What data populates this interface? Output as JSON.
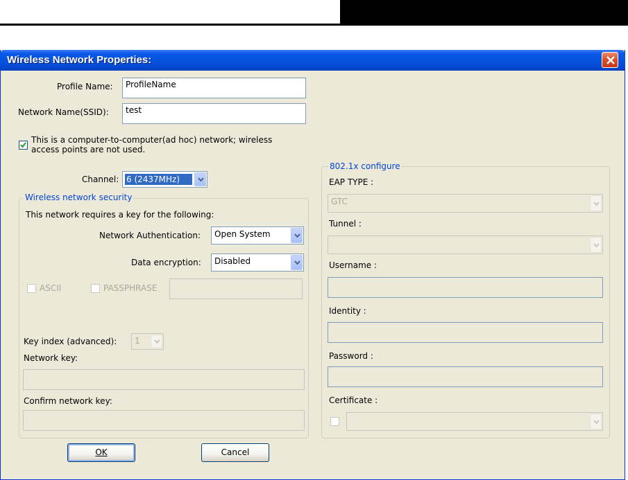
{
  "dialog": {
    "title": "Wireless Network Properties:",
    "close_glyph": "close-x"
  },
  "profile": {
    "name_label": "Profile Name:",
    "name_value": "ProfileName",
    "ssid_label": "Network Name(SSID):",
    "ssid_value": "test"
  },
  "adhoc": {
    "checked": true,
    "label_line1": "This is a computer-to-computer(ad hoc) network; wireless",
    "label_line2": "access points are not used."
  },
  "channel": {
    "label": "Channel:",
    "selected": "6  (2437MHz)"
  },
  "security": {
    "group_title": "Wireless network security",
    "intro": "This network requires a key for the following:",
    "auth_label": "Network Authentication:",
    "auth_selected": "Open System",
    "encryption_label": "Data encryption:",
    "encryption_selected": "Disabled",
    "ascii_label": "ASCII",
    "passphrase_label": "PASSPHRASE",
    "key_index_label": "Key index (advanced):",
    "key_index_selected": "1",
    "network_key_label": "Network key:",
    "confirm_key_label": "Confirm network key:"
  },
  "dot1x": {
    "group_title": "802.1x configure",
    "eap_type_label": "EAP TYPE :",
    "eap_type_selected": "GTC",
    "tunnel_label": "Tunnel :",
    "tunnel_selected": "",
    "username_label": "Username :",
    "identity_label": "Identity :",
    "password_label": "Password :",
    "certificate_label": "Certificate :"
  },
  "buttons": {
    "ok_label": "OK",
    "cancel_label": "Cancel"
  },
  "colors": {
    "titlebar": "#0653df",
    "dialog_bg": "#ece9d8",
    "group_title": "#0046d5",
    "close_button": "#d9532c"
  }
}
